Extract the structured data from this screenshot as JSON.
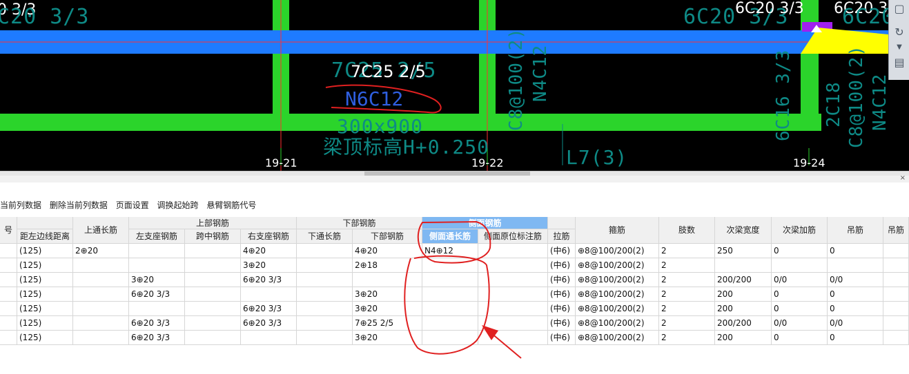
{
  "cad": {
    "top_labels": [
      "0 3/3",
      "C20 3/3",
      "6C20 3/3",
      "6C20 3/3",
      "6C20 3/",
      "6C20"
    ],
    "beam_main": "7C25 2/5",
    "beam_ghost": "7C25 2/5",
    "beam_side": "N6C12",
    "beam_section": "300x900",
    "beam_top_elev": "梁顶标高H+0.250",
    "vert_1": "C8@100(2)",
    "vert_2": "N4C12",
    "vert_3": "6C16 3/3",
    "vert_4": "2C18",
    "vert_5": "C8@100(2)",
    "vert_6": "N4C12",
    "beam_name": "L7(3)",
    "axes": [
      "19-21",
      "19-22",
      "19-24"
    ]
  },
  "right_tools": [
    "cube-icon",
    "rotate-icon",
    "dropdown-icon",
    "layers-icon"
  ],
  "panel": {
    "close": "×"
  },
  "toolbar": {
    "items": [
      "当前列数据",
      "删除当前列数据",
      "页面设置",
      "调换起始跨",
      "悬臂钢筋代号"
    ]
  },
  "table": {
    "group_top": "上部钢筋",
    "group_bottom": "下部钢筋",
    "group_side": "侧面钢筋",
    "h_no": "号",
    "h_dist": "距左边线距离",
    "h_top_cont": "上通长筋",
    "h_left_sup": "左支座钢筋",
    "h_mid": "跨中钢筋",
    "h_right_sup": "右支座钢筋",
    "h_bot_cont": "下通长筋",
    "h_bot": "下部钢筋",
    "h_side_cont": "侧面通长筋",
    "h_side_orig": "侧面原位标注筋",
    "h_tie": "拉筋",
    "h_stirrup": "箍筋",
    "h_legs": "肢数",
    "h_sec_width": "次梁宽度",
    "h_sec_add": "次梁加筋",
    "h_hanger": "吊筋",
    "h_hanger2": "吊筋",
    "rows": [
      [
        "(125)",
        "2⊕20",
        "",
        "",
        "4⊕20",
        "",
        "4⊕20",
        "N4⊕12",
        "",
        "(中6)",
        "⊕8@100/200(2)",
        "2",
        "250",
        "0",
        "0"
      ],
      [
        "(125)",
        "",
        "",
        "",
        "3⊕20",
        "",
        "2⊕18",
        "",
        "",
        "(中6)",
        "⊕8@100/200(2)",
        "2",
        "",
        "",
        ""
      ],
      [
        "(125)",
        "",
        "3⊕20",
        "",
        "6⊕20 3/3",
        "",
        "",
        "",
        "",
        "(中6)",
        "⊕8@100/200(2)",
        "2",
        "200/200",
        "0/0",
        "0/0"
      ],
      [
        "(125)",
        "",
        "6⊕20 3/3",
        "",
        "",
        "",
        "3⊕20",
        "",
        "",
        "(中6)",
        "⊕8@100/200(2)",
        "2",
        "200",
        "0",
        "0"
      ],
      [
        "(125)",
        "",
        "",
        "",
        "6⊕20 3/3",
        "",
        "3⊕20",
        "",
        "",
        "(中6)",
        "⊕8@100/200(2)",
        "2",
        "200",
        "0",
        "0"
      ],
      [
        "(125)",
        "",
        "6⊕20 3/3",
        "",
        "6⊕20 3/3",
        "",
        "7⊕25 2/5",
        "",
        "",
        "(中6)",
        "⊕8@100/200(2)",
        "2",
        "200/200",
        "0/0",
        "0/0"
      ],
      [
        "(125)",
        "",
        "6⊕20 3/3",
        "",
        "",
        "",
        "3⊕20",
        "",
        "",
        "(中6)",
        "⊕8@100/200(2)",
        "2",
        "200",
        "0",
        "0"
      ]
    ]
  },
  "colors": {
    "cad_bg": "#000000",
    "beam_green": "#2bd42b",
    "beam_blue": "#1e7bff",
    "selected_header": "#7fb8f2",
    "annotation_red": "#e02020"
  }
}
